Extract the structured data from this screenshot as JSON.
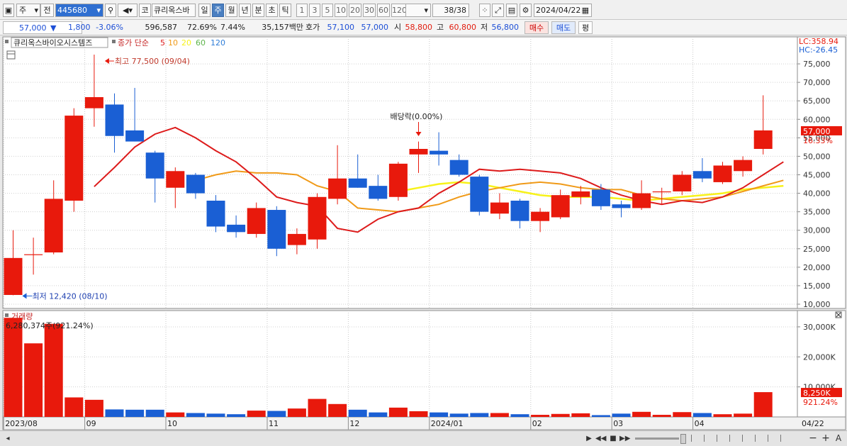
{
  "toolbar": {
    "type_select": "주",
    "prev_label": "전",
    "code": "445680",
    "name_button": "코",
    "stock_name": "큐리옥스바",
    "periods": [
      "일",
      "주",
      "월",
      "년",
      "분",
      "초",
      "틱"
    ],
    "selected_period": "주",
    "intervals": [
      "1",
      "3",
      "5",
      "10",
      "20",
      "30",
      "60",
      "120"
    ],
    "count": "38/38",
    "date": "2024/04/22"
  },
  "quote": {
    "price": "57,000",
    "change_arrow": "▼",
    "change": "1,800",
    "change_pct": "-3.06%",
    "volume": "596,587",
    "volume_ratio": "72.69%",
    "turnover": "7.44%",
    "amount": "35,157백만",
    "ask_label": "호가",
    "ask": "57,100",
    "bid": "57,000",
    "open_label": "시",
    "open": "58,800",
    "high_label": "고",
    "high": "60,800",
    "low_label": "저",
    "low": "56,800",
    "buy_label": "매수",
    "sell_label": "매도",
    "flat_label": "평"
  },
  "legend": {
    "stock_name": "큐리옥스바이오시스템즈",
    "ma_title": "종가 단순",
    "ma_periods": [
      "5",
      "10",
      "20",
      "60",
      "120"
    ],
    "lc_label": "LC:358.94",
    "hc_label": "HC:-26.45"
  },
  "annotations": {
    "high": "최고 77,500 (09/04)",
    "low": "최저 12,420 (08/10)",
    "dividend": "배당락(0.00%)"
  },
  "price_badge": {
    "value": "57,000",
    "pct": "16.33%"
  },
  "volume_panel": {
    "title": "거래량",
    "value": "6,280,374주(921.24%)",
    "badge": "8,250K",
    "badge_pct": "921.24%"
  },
  "colors": {
    "up": "#e8190c",
    "down": "#1a5fd4",
    "ma5": "#dd1b1b",
    "ma10": "#f09a18",
    "ma20": "#f7f21a",
    "ma60": "#5eb44b",
    "ma120": "#2e7dd8"
  },
  "chart_data": {
    "type": "candlestick",
    "price_axis": {
      "ylim": [
        10000,
        80000
      ],
      "ticks": [
        "10,000",
        "15,000",
        "20,000",
        "25,000",
        "30,000",
        "35,000",
        "40,000",
        "45,000",
        "50,000",
        "55,000",
        "60,000",
        "65,000",
        "70,000",
        "75,000"
      ]
    },
    "volume_axis": {
      "ylim": [
        0,
        34000
      ],
      "unit": "K",
      "ticks": [
        "10,000K",
        "20,000K",
        "30,000K"
      ]
    },
    "x_labels": [
      "2023/08",
      "09",
      "10",
      "11",
      "12",
      "2024/01",
      "02",
      "03",
      "04"
    ],
    "x_label_index": [
      0,
      4,
      8,
      13,
      17,
      21,
      26,
      30,
      34
    ],
    "last_label": "04/22",
    "candles": [
      {
        "o": 12500,
        "h": 30000,
        "l": 12420,
        "c": 22500,
        "v": 33000
      },
      {
        "o": 23500,
        "h": 28000,
        "l": 18000,
        "c": 23500,
        "v": 24500
      },
      {
        "o": 24000,
        "h": 43500,
        "l": 23500,
        "c": 38500,
        "v": 31000
      },
      {
        "o": 38000,
        "h": 63000,
        "l": 35000,
        "c": 61000,
        "v": 6500
      },
      {
        "o": 63000,
        "h": 77500,
        "l": 58000,
        "c": 66000,
        "v": 5700
      },
      {
        "o": 64000,
        "h": 67000,
        "l": 51000,
        "c": 55500,
        "v": 2500
      },
      {
        "o": 57000,
        "h": 68500,
        "l": 54000,
        "c": 54000,
        "v": 2400
      },
      {
        "o": 51000,
        "h": 51500,
        "l": 37500,
        "c": 44000,
        "v": 2400
      },
      {
        "o": 41500,
        "h": 47000,
        "l": 36000,
        "c": 46000,
        "v": 1500
      },
      {
        "o": 45000,
        "h": 45500,
        "l": 38500,
        "c": 40000,
        "v": 1300
      },
      {
        "o": 38000,
        "h": 39500,
        "l": 29500,
        "c": 31000,
        "v": 1100
      },
      {
        "o": 31500,
        "h": 34000,
        "l": 28000,
        "c": 29500,
        "v": 900
      },
      {
        "o": 29000,
        "h": 37500,
        "l": 28000,
        "c": 36000,
        "v": 2100
      },
      {
        "o": 35500,
        "h": 36500,
        "l": 23000,
        "c": 25000,
        "v": 2000
      },
      {
        "o": 26000,
        "h": 30500,
        "l": 23500,
        "c": 29000,
        "v": 2800
      },
      {
        "o": 27500,
        "h": 40000,
        "l": 25000,
        "c": 39000,
        "v": 6000
      },
      {
        "o": 38500,
        "h": 53000,
        "l": 37000,
        "c": 44000,
        "v": 4300
      },
      {
        "o": 44000,
        "h": 50500,
        "l": 41500,
        "c": 41500,
        "v": 2400
      },
      {
        "o": 42000,
        "h": 45000,
        "l": 38000,
        "c": 38500,
        "v": 1500
      },
      {
        "o": 39000,
        "h": 48500,
        "l": 38000,
        "c": 48000,
        "v": 3100
      },
      {
        "o": 50500,
        "h": 54000,
        "l": 45500,
        "c": 52000,
        "v": 1900
      },
      {
        "o": 51500,
        "h": 56500,
        "l": 47500,
        "c": 50500,
        "v": 1500
      },
      {
        "o": 49000,
        "h": 50500,
        "l": 44500,
        "c": 45000,
        "v": 1100
      },
      {
        "o": 44500,
        "h": 45000,
        "l": 34000,
        "c": 35000,
        "v": 1300
      },
      {
        "o": 34500,
        "h": 40000,
        "l": 33000,
        "c": 37500,
        "v": 1300
      },
      {
        "o": 38000,
        "h": 38500,
        "l": 30500,
        "c": 32500,
        "v": 900
      },
      {
        "o": 32500,
        "h": 36000,
        "l": 29500,
        "c": 35000,
        "v": 700
      },
      {
        "o": 33500,
        "h": 41000,
        "l": 33000,
        "c": 39500,
        "v": 1000
      },
      {
        "o": 39000,
        "h": 42000,
        "l": 37000,
        "c": 40500,
        "v": 1200
      },
      {
        "o": 41000,
        "h": 42500,
        "l": 35500,
        "c": 36500,
        "v": 600
      },
      {
        "o": 37000,
        "h": 38000,
        "l": 33500,
        "c": 36000,
        "v": 1100
      },
      {
        "o": 36000,
        "h": 43500,
        "l": 35500,
        "c": 40000,
        "v": 1700
      },
      {
        "o": 40500,
        "h": 41500,
        "l": 37000,
        "c": 40500,
        "v": 700
      },
      {
        "o": 40500,
        "h": 46000,
        "l": 39500,
        "c": 45000,
        "v": 1600
      },
      {
        "o": 46000,
        "h": 49500,
        "l": 43000,
        "c": 44000,
        "v": 1300
      },
      {
        "o": 43000,
        "h": 48500,
        "l": 42500,
        "c": 47500,
        "v": 900
      },
      {
        "o": 46000,
        "h": 50000,
        "l": 44500,
        "c": 49000,
        "v": 1100
      },
      {
        "o": 52000,
        "h": 66500,
        "l": 50500,
        "c": 57000,
        "v": 8250
      }
    ],
    "ma5": [
      null,
      null,
      null,
      null,
      41800,
      47000,
      52500,
      56000,
      57800,
      55000,
      51500,
      48500,
      44000,
      39000,
      37500,
      36500,
      30500,
      29500,
      33000,
      35000,
      36000,
      40000,
      43000,
      46500,
      46000,
      46500,
      46000,
      45500,
      44000,
      41500,
      39500,
      38000,
      37000,
      38000,
      37500,
      39000,
      41500,
      45000,
      48500
    ],
    "ma10": [
      null,
      null,
      null,
      null,
      null,
      null,
      null,
      null,
      null,
      43500,
      45000,
      46000,
      45500,
      45500,
      45000,
      42000,
      40500,
      36000,
      35500,
      35000,
      36000,
      37000,
      39000,
      40500,
      41500,
      42500,
      43000,
      42500,
      41500,
      41000,
      41000,
      39500,
      38500,
      38000,
      38500,
      39000,
      40500,
      42000,
      43500
    ],
    "ma20": [
      null,
      null,
      null,
      null,
      null,
      null,
      null,
      null,
      null,
      null,
      null,
      null,
      null,
      null,
      null,
      null,
      null,
      null,
      null,
      40500,
      41500,
      42500,
      43000,
      42500,
      41500,
      40500,
      39500,
      39000,
      39000,
      39000,
      38500,
      38000,
      38500,
      39000,
      39500,
      40000,
      41000,
      41500,
      42000
    ]
  },
  "scrollbar": {
    "buttons": [
      "▶",
      "◀◀",
      "■",
      "▶▶",
      "−",
      "+",
      "A"
    ]
  }
}
